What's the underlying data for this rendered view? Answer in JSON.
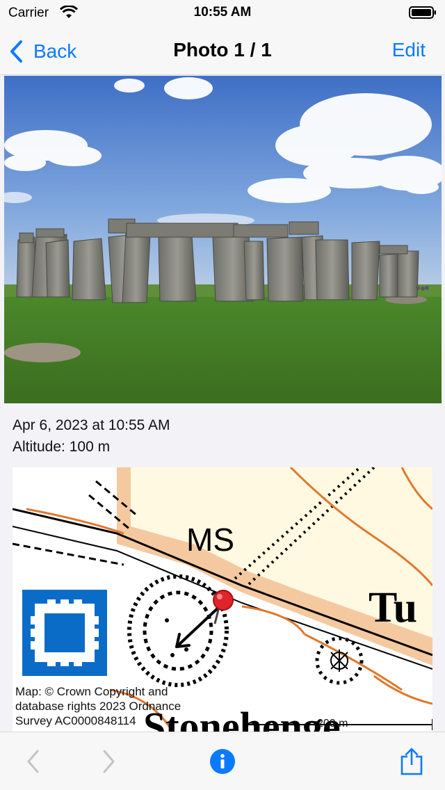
{
  "status_bar": {
    "carrier": "Carrier",
    "time": "10:55 AM"
  },
  "nav": {
    "back_label": "Back",
    "title": "Photo 1 / 1",
    "edit_label": "Edit"
  },
  "photo_info": {
    "date": "Apr 6, 2023 at 10:55 AM",
    "altitude": "Altitude: 100 m"
  },
  "map": {
    "label_ms": "MS",
    "label_tu": "Tu",
    "label_stonehenge": "Stonehenge",
    "attribution": "Map: © Crown Copyright and database rights 2023 Ordnance Survey AC0000848114",
    "scale_label": "200 m"
  },
  "colors": {
    "accent": "#0a7aff",
    "pin": "#e0242a",
    "heritage": "#0b6cc7",
    "road": "#f5c9a0"
  },
  "icons": [
    "back-chevron-icon",
    "wifi-icon",
    "battery-icon",
    "map-pin-icon",
    "heritage-site-icon",
    "previous-icon",
    "next-icon",
    "info-icon",
    "share-icon"
  ]
}
